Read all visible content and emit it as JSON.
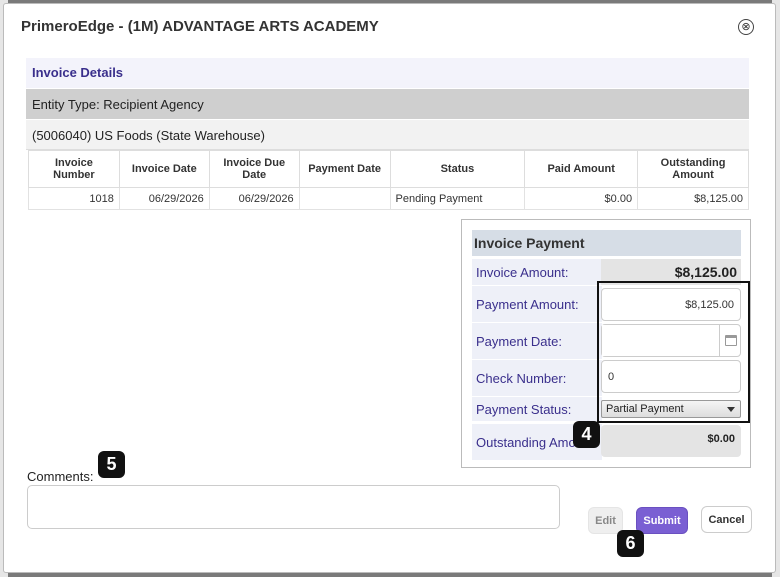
{
  "modal": {
    "title": "PrimeroEdge - (1M) ADVANTAGE ARTS ACADEMY",
    "close_icon": "⊗"
  },
  "invoice_details": {
    "header": "Invoice Details",
    "entity_type": "Entity Type: Recipient Agency",
    "vendor": "(5006040) US Foods (State Warehouse)",
    "columns": [
      "Invoice Number",
      "Invoice Date",
      "Invoice Due Date",
      "Payment Date",
      "Status",
      "Paid Amount",
      "Outstanding Amount"
    ],
    "rows": [
      {
        "invoice_number": "1018",
        "invoice_date": "06/29/2026",
        "due_date": "06/29/2026",
        "payment_date": "",
        "status": "Pending Payment",
        "paid_amount": "$0.00",
        "outstanding_amount": "$8,125.00"
      }
    ]
  },
  "invoice_payment": {
    "title": "Invoice Payment",
    "invoice_amount_label": "Invoice Amount:",
    "invoice_amount_value": "$8,125.00",
    "payment_amount_label": "Payment Amount:",
    "payment_amount_value": "$8,125.00",
    "payment_date_label": "Payment Date:",
    "payment_date_value": "",
    "check_number_label": "Check Number:",
    "check_number_value": "0",
    "payment_status_label": "Payment Status:",
    "payment_status_value": "Partial Payment",
    "outstanding_label": "Outstanding Amou",
    "outstanding_value": "$0.00"
  },
  "comments": {
    "label": "Comments:"
  },
  "buttons": {
    "edit": "Edit",
    "submit": "Submit",
    "cancel": "Cancel"
  },
  "callouts": {
    "four": "4",
    "five": "5",
    "six": "6"
  }
}
